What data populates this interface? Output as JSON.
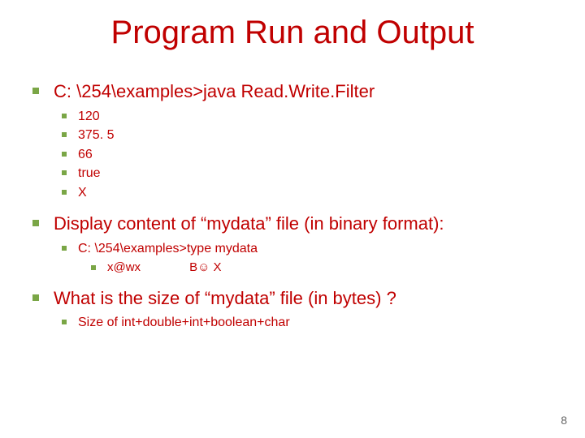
{
  "title": "Program Run and Output",
  "b1": "C: \\254\\examples>java Read.Write.Filter",
  "b1_sub": [
    "120",
    "375. 5",
    "66",
    "true",
    "X"
  ],
  "b2": "Display content of “mydata” file (in binary format):",
  "b2_sub1": "C: \\254\\examples>type mydata",
  "b2_sub1_a": "x@wx",
  "b2_sub1_b": "B☺ X",
  "b3": "What is the size of “mydata” file (in bytes) ?",
  "b3_sub1": "Size of int+double+int+boolean+char",
  "page_number": "8"
}
